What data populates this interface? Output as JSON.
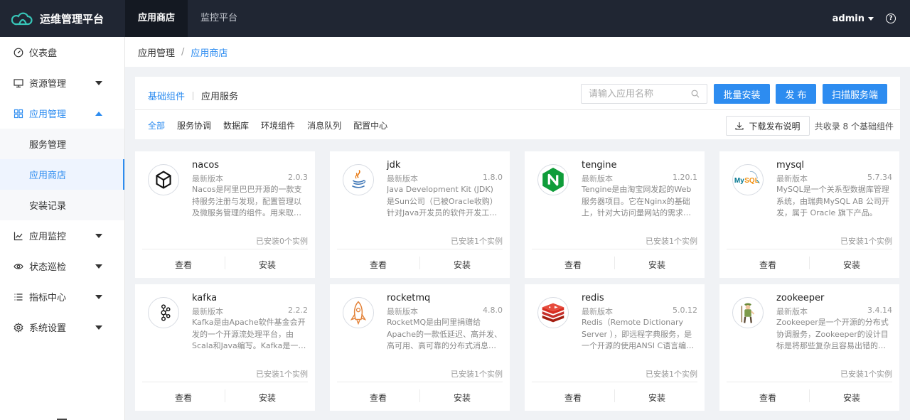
{
  "app": {
    "title": "运维管理平台"
  },
  "topnav": [
    {
      "label": "应用商店",
      "active": true
    },
    {
      "label": "监控平台",
      "active": false
    }
  ],
  "user": {
    "name": "admin",
    "help": "?"
  },
  "sidebar": {
    "items": [
      {
        "label": "仪表盘",
        "icon": "dashboard-icon"
      },
      {
        "label": "资源管理",
        "icon": "monitor-icon"
      },
      {
        "label": "应用管理",
        "icon": "grid-icon"
      },
      {
        "label": "应用监控",
        "icon": "chart-icon"
      },
      {
        "label": "状态巡检",
        "icon": "eye-icon"
      },
      {
        "label": "指标中心",
        "icon": "list-icon"
      },
      {
        "label": "系统设置",
        "icon": "gear-icon"
      }
    ],
    "subitems": [
      {
        "label": "服务管理"
      },
      {
        "label": "应用商店"
      },
      {
        "label": "安装记录"
      }
    ]
  },
  "breadcrumb": {
    "parent": "应用管理",
    "separator": "/",
    "current": "应用商店"
  },
  "tabs": [
    {
      "label": "基础组件",
      "active": true
    },
    {
      "label": "应用服务",
      "active": false
    }
  ],
  "search": {
    "placeholder": "请输入应用名称"
  },
  "buttons": {
    "batch_install": "批量安装",
    "publish": "发 布",
    "scan": "扫描服务端",
    "download": "下载发布说明"
  },
  "filters": [
    {
      "label": "全部",
      "active": true
    },
    {
      "label": "服务协调"
    },
    {
      "label": "数据库"
    },
    {
      "label": "环境组件"
    },
    {
      "label": "消息队列"
    },
    {
      "label": "配置中心"
    }
  ],
  "total_text": "共收录 8 个基础组件",
  "version_label": "最新版本",
  "actions": {
    "view": "查看",
    "install": "安装"
  },
  "cards": [
    {
      "name": "nacos",
      "version": "2.0.3",
      "desc": "Nacos是阿里巴巴开源的一款支持服务注册与发现，配置管理以及微服务管理的组件。用来取代以前常用的注册中心和配置中心。",
      "installed": "已安装0个实例",
      "icon": "nacos-icon"
    },
    {
      "name": "jdk",
      "version": "1.8.0",
      "desc": "Java Development Kit (JDK) 是Sun公司（已被Oracle收购）针对Java开发员的软件开发工具包。",
      "installed": "已安装1个实例",
      "icon": "java-icon"
    },
    {
      "name": "tengine",
      "version": "1.20.1",
      "desc": "Tengine是由淘宝网发起的Web服务器项目。它在Nginx的基础上，针对大访问量网站的需求，添加了很多高级功能和特性。",
      "installed": "已安装1个实例",
      "icon": "nginx-icon"
    },
    {
      "name": "mysql",
      "version": "5.7.34",
      "desc": "MySQL是一个关系型数据库管理系统，由瑞典MySQL AB 公司开发，属于 Oracle 旗下产品。",
      "installed": "已安装1个实例",
      "icon": "mysql-icon"
    },
    {
      "name": "kafka",
      "version": "2.2.2",
      "desc": "Kafka是由Apache软件基金会开发的一个开源流处理平台，由Scala和Java编写。Kafka是一种高吞吐量的分布式发布订阅消息系统。",
      "installed": "已安装1个实例",
      "icon": "kafka-icon"
    },
    {
      "name": "rocketmq",
      "version": "4.8.0",
      "desc": "RocketMQ是由阿里捐赠给Apache的一款低延迟、高并发、高可用、高可靠的分布式消息中间件。",
      "installed": "已安装1个实例",
      "icon": "rocket-icon"
    },
    {
      "name": "redis",
      "version": "5.0.12",
      "desc": "Redis（Remote Dictionary Server ），即远程字典服务，是一个开源的使用ANSI C语言编写、支持网络的数据库。",
      "installed": "已安装1个实例",
      "icon": "redis-icon"
    },
    {
      "name": "zookeeper",
      "version": "3.4.14",
      "desc": "Zookeeper是一个开源的分布式协调服务，Zookeeper的设计目标是将那些复杂且容易出错的分布式一致性服务封装起来。",
      "installed": "已安装1个实例",
      "icon": "zookeeper-icon"
    }
  ]
}
